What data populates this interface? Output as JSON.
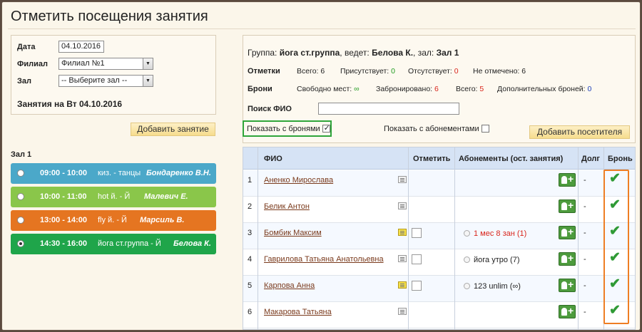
{
  "page": {
    "title": "Отметить посещения занятия"
  },
  "filter": {
    "date_label": "Дата",
    "date_value": "04.10.2016",
    "branch_label": "Филиал",
    "branch_value": "Филиал №1",
    "hall_label": "Зал",
    "hall_value": "-- Выберите зал --",
    "session_title": "Занятия на Вт 04.10.2016"
  },
  "add_session_label": "Добавить занятие",
  "schedule": {
    "hall": "Зал 1",
    "slots": [
      {
        "time": "09:00 - 10:00",
        "name": "киз. - танцы",
        "trainer": "Бондаренко В.Н.",
        "color": "#4ba8c9",
        "selected": false
      },
      {
        "time": "10:00 - 11:00",
        "name": "hot й. - Й",
        "trainer": "Малевич Е.",
        "color": "#8ac64a",
        "selected": false
      },
      {
        "time": "13:00 - 14:00",
        "name": "fly й. - Й",
        "trainer": "Марсиль В.",
        "color": "#e57521",
        "selected": false
      },
      {
        "time": "14:30 - 16:00",
        "name": "йога ст.группа - Й",
        "trainer": "Белова К.",
        "color": "#1fa54a",
        "selected": true
      }
    ]
  },
  "info": {
    "group_prefix": "Группа:",
    "group_name": "йога ст.группа",
    "leads_prefix": ", ведет:",
    "leader": "Белова К.",
    "hall_prefix": ", зал:",
    "hall": "Зал 1",
    "marks_label": "Отметки",
    "marks": {
      "total_label": "Всего:",
      "total": "6",
      "present_label": "Присутствует:",
      "present": "0",
      "absent_label": "Отсутствует:",
      "absent": "0",
      "unmarked_label": "Не отмечено:",
      "unmarked": "6"
    },
    "bookings_label": "Брони",
    "bookings": {
      "free_label": "Свободно мест:",
      "free": "∞",
      "booked_label": "Забронировано:",
      "booked": "6",
      "total_label": "Всего:",
      "total": "5",
      "extra_label": "Дополнительных броней:",
      "extra": "0"
    },
    "search_label": "Поиск ФИО",
    "search_value": "",
    "show_bookings_label": "Показать с бронями",
    "show_subscriptions_label": "Показать с абонементами",
    "add_visitor_label": "Добавить посетителя"
  },
  "table": {
    "headers": {
      "fio": "ФИО",
      "mark": "Отметить",
      "subs": "Абонементы (ост. занятия)",
      "debt": "Долг",
      "booking": "Бронь"
    },
    "rows": [
      {
        "n": "1",
        "fio": "Аненко Мирослава",
        "note_yellow": false,
        "has_checkbox": false,
        "subscription": "",
        "sub_color": "#222",
        "debt": "-"
      },
      {
        "n": "2",
        "fio": "Белик Антон",
        "note_yellow": false,
        "has_checkbox": false,
        "subscription": "",
        "sub_color": "#222",
        "debt": "-"
      },
      {
        "n": "3",
        "fio": "Бомбик Максим",
        "note_yellow": true,
        "has_checkbox": true,
        "subscription": "1 мес 8 зан (1)",
        "sub_color": "#d9261c",
        "debt": "-"
      },
      {
        "n": "4",
        "fio": "Гаврилова Татьяна Анатольевна",
        "note_yellow": false,
        "has_checkbox": true,
        "subscription": "йога утро (7)",
        "sub_color": "#222",
        "debt": "-"
      },
      {
        "n": "5",
        "fio": "Карпова Анна",
        "note_yellow": true,
        "has_checkbox": true,
        "subscription": "123 unlim (∞)",
        "sub_color": "#222",
        "debt": "-"
      },
      {
        "n": "6",
        "fio": "Макарова Татьяна",
        "note_yellow": false,
        "has_checkbox": false,
        "subscription": "",
        "sub_color": "#222",
        "debt": "-"
      }
    ]
  }
}
